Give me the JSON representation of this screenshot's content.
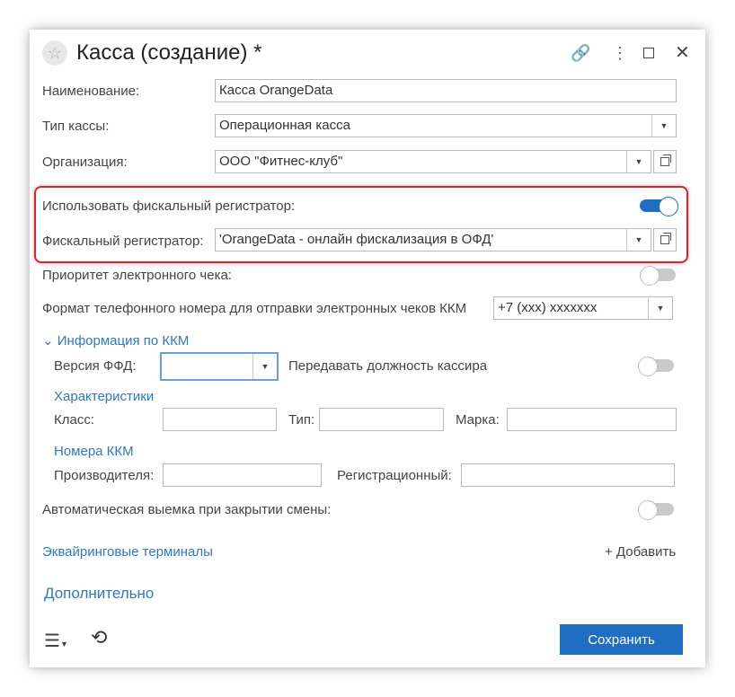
{
  "window": {
    "title": "Касса (создание) *",
    "star_icon": "star-icon",
    "link_icon": "link-icon",
    "more_icon": "more-icon",
    "maximize_icon": "maximize-icon",
    "close_icon": "close-icon"
  },
  "form": {
    "name": {
      "label": "Наименование:",
      "value": "Касса OrangeData"
    },
    "register_type": {
      "label": "Тип кассы:",
      "value": "Операционная касса"
    },
    "organization": {
      "label": "Организация:",
      "value": "ООО \"Фитнес-клуб\""
    },
    "use_fiscal": {
      "label": "Использовать фискальный регистратор:",
      "enabled": true
    },
    "fiscal": {
      "label": "Фискальный регистратор:",
      "value": "'OrangeData - онлайн фискализация в ОФД'"
    },
    "priority": {
      "label": "Приоритет электронного чека:",
      "enabled": false
    },
    "phone_format": {
      "label": "Формат телефонного номера для отправки электронных чеков ККМ",
      "value": "+7 (xxx) xxxxxxx"
    },
    "kkm_info": {
      "title": "Информация по ККМ",
      "ffd_label": "Версия ФФД:",
      "ffd_value": "",
      "cashier_label": "Передавать должность кассира",
      "cashier_enabled": false
    },
    "characteristics": {
      "title": "Характеристики",
      "class_label": "Класс:",
      "type_label": "Тип:",
      "brand_label": "Марка:"
    },
    "kkm_numbers": {
      "title": "Номера ККМ",
      "maker_label": "Производителя:",
      "reg_label": "Регистрационный:"
    },
    "auto_withdrawal": {
      "label": "Автоматическая выемка при закрытии смены:",
      "enabled": false
    },
    "acquiring": {
      "title": "Эквайринговые терминалы",
      "add_label": "+ Добавить"
    },
    "additional": {
      "title": "Дополнительно"
    }
  },
  "footer": {
    "menu_icon": "menu-icon",
    "history_icon": "history-icon",
    "save_label": "Сохранить"
  },
  "colors": {
    "accent": "#1e6fc4",
    "link": "#2e79c4",
    "highlight": "#d9232a"
  }
}
